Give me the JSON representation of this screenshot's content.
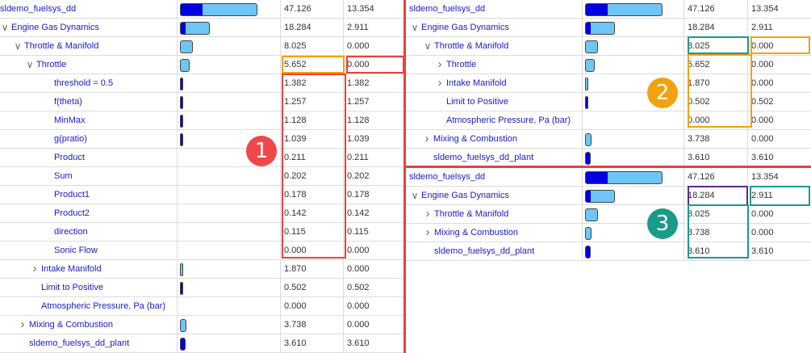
{
  "colors": {
    "link_text": "#1a1ac8",
    "bar_total": "#6ec6f5",
    "bar_self": "#0000e0",
    "callout_red": "#e84040",
    "callout_orange": "#f2a20d",
    "callout_teal": "#1a9b8a",
    "callout_purple": "#5a2a8a"
  },
  "icons": {
    "expanded": "chevron-down-icon",
    "collapsed": "chevron-right-icon"
  },
  "badges": [
    "1",
    "2",
    "3"
  ],
  "left_panel": {
    "rows": [
      {
        "label": "sldemo_fuelsys_dd",
        "total": "47.126",
        "self": "13.354",
        "bar_total": 1.0,
        "bar_self": 0.283
      },
      {
        "label": "Engine Gas Dynamics",
        "total": "18.284",
        "self": "2.911",
        "bar_total": 0.388,
        "bar_self": 0.062
      },
      {
        "label": "Throttle & Manifold",
        "total": "8.025",
        "self": "0.000",
        "bar_total": 0.17,
        "bar_self": 0.0
      },
      {
        "label": "Throttle",
        "total": "5.652",
        "self": "0.000",
        "bar_total": 0.12,
        "bar_self": 0.0
      },
      {
        "label": "threshold = 0.5",
        "total": "1.382",
        "self": "1.382",
        "bar_total": 0.029,
        "bar_self": 0.029
      },
      {
        "label": "f(theta)",
        "total": "1.257",
        "self": "1.257",
        "bar_total": 0.027,
        "bar_self": 0.027
      },
      {
        "label": "MinMax",
        "total": "1.128",
        "self": "1.128",
        "bar_total": 0.024,
        "bar_self": 0.024
      },
      {
        "label": "g(pratio)",
        "total": "1.039",
        "self": "1.039",
        "bar_total": 0.022,
        "bar_self": 0.022
      },
      {
        "label": "Product",
        "total": "0.211",
        "self": "0.211",
        "bar_total": 0.0,
        "bar_self": 0.0
      },
      {
        "label": "Sum",
        "total": "0.202",
        "self": "0.202",
        "bar_total": 0.0,
        "bar_self": 0.0
      },
      {
        "label": "Product1",
        "total": "0.178",
        "self": "0.178",
        "bar_total": 0.0,
        "bar_self": 0.0
      },
      {
        "label": "Product2",
        "total": "0.142",
        "self": "0.142",
        "bar_total": 0.0,
        "bar_self": 0.0
      },
      {
        "label": "direction",
        "total": "0.115",
        "self": "0.115",
        "bar_total": 0.0,
        "bar_self": 0.0
      },
      {
        "label": "Sonic Flow",
        "total": "0.000",
        "self": "0.000",
        "bar_total": 0.0,
        "bar_self": 0.0
      },
      {
        "label": "Intake Manifold",
        "total": "1.870",
        "self": "0.000",
        "bar_total": 0.04,
        "bar_self": 0.0
      },
      {
        "label": "Limit to Positive",
        "total": "0.502",
        "self": "0.502",
        "bar_total": 0.011,
        "bar_self": 0.011
      },
      {
        "label": "Atmospheric Pressure, Pa (bar)",
        "total": "0.000",
        "self": "0.000",
        "bar_total": 0.0,
        "bar_self": 0.0
      },
      {
        "label": "Mixing & Combustion",
        "total": "3.738",
        "self": "0.000",
        "bar_total": 0.079,
        "bar_self": 0.0
      },
      {
        "label": "sldemo_fuelsys_dd_plant",
        "total": "3.610",
        "self": "3.610",
        "bar_total": 0.077,
        "bar_self": 0.077
      }
    ]
  },
  "top_right_panel": {
    "rows": [
      {
        "label": "sldemo_fuelsys_dd",
        "total": "47.126",
        "self": "13.354",
        "bar_total": 1.0,
        "bar_self": 0.283
      },
      {
        "label": "Engine Gas Dynamics",
        "total": "18.284",
        "self": "2.911",
        "bar_total": 0.388,
        "bar_self": 0.062
      },
      {
        "label": "Throttle & Manifold",
        "total": "8.025",
        "self": "0.000",
        "bar_total": 0.17,
        "bar_self": 0.0
      },
      {
        "label": "Throttle",
        "total": "5.652",
        "self": "0.000",
        "bar_total": 0.12,
        "bar_self": 0.0
      },
      {
        "label": "Intake Manifold",
        "total": "1.870",
        "self": "0.000",
        "bar_total": 0.04,
        "bar_self": 0.0
      },
      {
        "label": "Limit to Positive",
        "total": "0.502",
        "self": "0.502",
        "bar_total": 0.011,
        "bar_self": 0.011
      },
      {
        "label": "Atmospheric Pressure, Pa (bar)",
        "total": "0.000",
        "self": "0.000",
        "bar_total": 0.0,
        "bar_self": 0.0
      },
      {
        "label": "Mixing & Combustion",
        "total": "3.738",
        "self": "0.000",
        "bar_total": 0.079,
        "bar_self": 0.0
      },
      {
        "label": "sldemo_fuelsys_dd_plant",
        "total": "3.610",
        "self": "3.610",
        "bar_total": 0.077,
        "bar_self": 0.077
      }
    ]
  },
  "bottom_right_panel": {
    "rows": [
      {
        "label": "sldemo_fuelsys_dd",
        "total": "47.126",
        "self": "13.354",
        "bar_total": 1.0,
        "bar_self": 0.283
      },
      {
        "label": "Engine Gas Dynamics",
        "total": "18.284",
        "self": "2.911",
        "bar_total": 0.388,
        "bar_self": 0.062
      },
      {
        "label": "Throttle & Manifold",
        "total": "8.025",
        "self": "0.000",
        "bar_total": 0.17,
        "bar_self": 0.0
      },
      {
        "label": "Mixing & Combustion",
        "total": "3.738",
        "self": "0.000",
        "bar_total": 0.079,
        "bar_self": 0.0
      },
      {
        "label": "sldemo_fuelsys_dd_plant",
        "total": "3.610",
        "self": "3.610",
        "bar_total": 0.077,
        "bar_self": 0.077
      }
    ]
  }
}
